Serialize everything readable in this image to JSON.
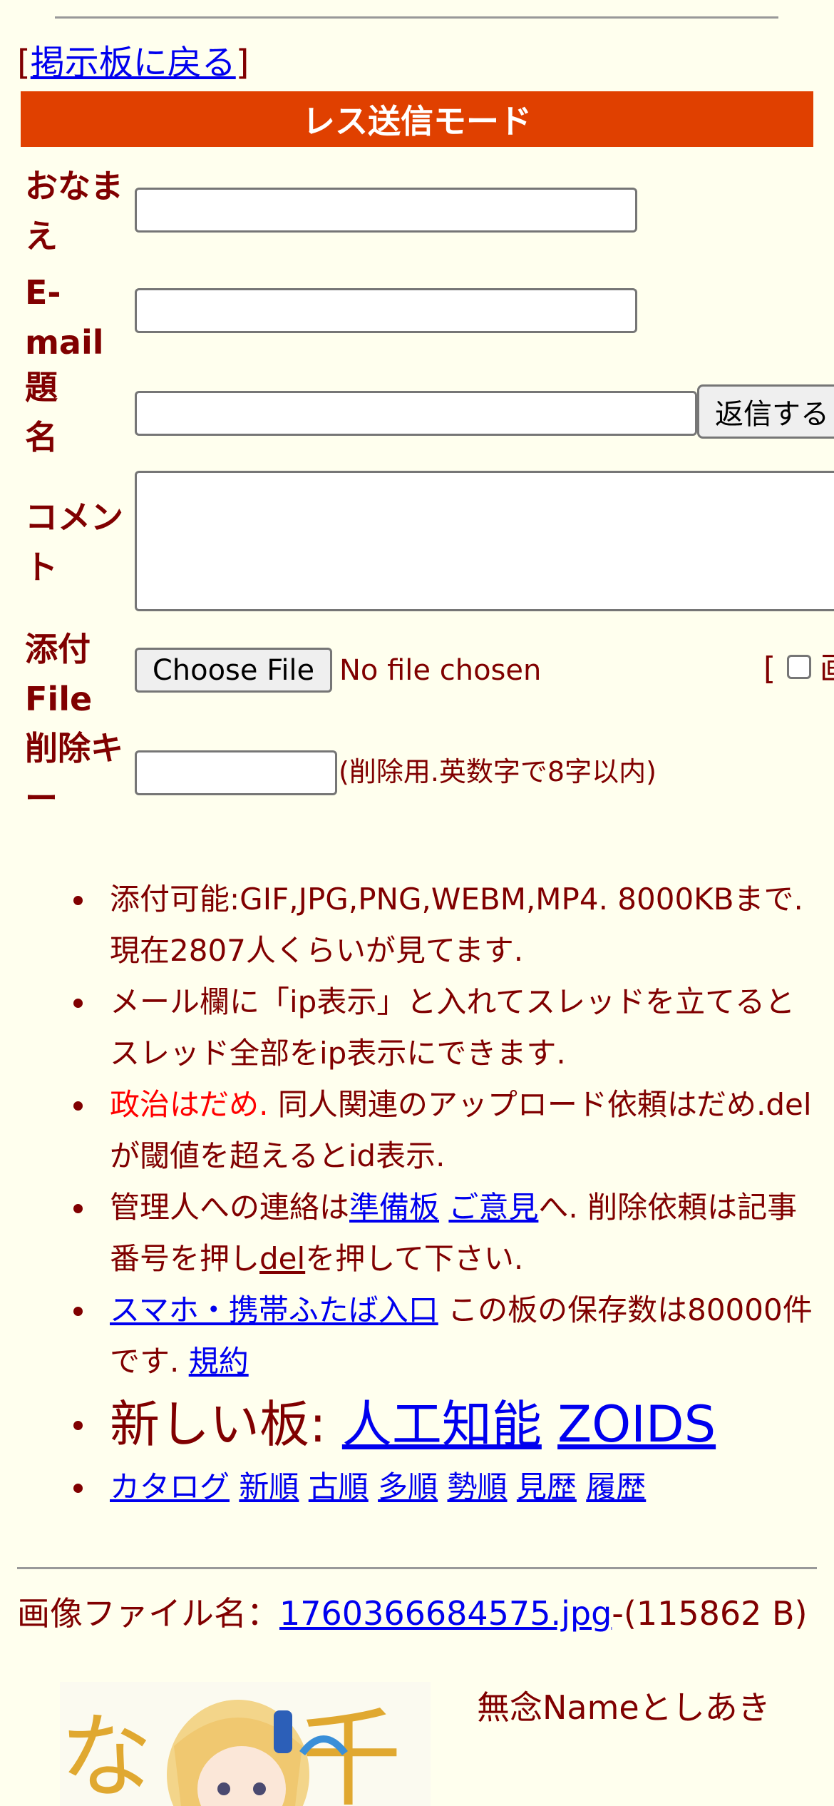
{
  "nav": {
    "back_open": "[",
    "back_label": "掲示板に戻る",
    "back_close": "]"
  },
  "form": {
    "mode_title": "レス送信モード",
    "name_label": "おなまえ",
    "email_label": "E-mail",
    "subject_label": "題名",
    "submit_label": "返信する",
    "comment_label": "コメント",
    "attach_label": "添付File",
    "choose_file_label": "Choose File",
    "no_file_text": "No file chosen",
    "option_bracket": "[",
    "option_cut_text": "画",
    "delkey_label": "削除キー",
    "delkey_note": "(削除用.英数字で8字以内)"
  },
  "notes": {
    "n1": "添付可能:GIF,JPG,PNG,WEBM,MP4. 8000KBまで. 現在2807人くらいが見てます.",
    "n2": "メール欄に「ip表示」と入れてスレッドを立てるとスレッド全部をip表示にできます.",
    "n3_red": "政治はだめ.",
    "n3_rest": " 同人関連のアップロード依頼はだめ.delが閾値を超えるとid表示.",
    "n4_pre": "管理人への連絡は",
    "n4_link1": "準備板",
    "n4_link2": "ご意見",
    "n4_mid": "へ. 削除依頼は記事番号を押し",
    "n4_link3": "del",
    "n4_post": "を押して下さい.",
    "n5_link": "スマホ・携帯ふたば入口",
    "n5_mid": " この板の保存数は80000件です. ",
    "n5_link2": "規約",
    "n6_pre": "新しい板: ",
    "n6_link1": "人工知能",
    "n6_link2": "ZOIDS",
    "sort_links": [
      "カタログ",
      "新順",
      "古順",
      "多順",
      "勢順",
      "見歴",
      "履歴"
    ]
  },
  "post": {
    "file_prefix": "画像ファイル名：",
    "file_name": "1760366684575.jpg",
    "file_size": "-(115862 B)",
    "poster_name": "無念Nameとしあき"
  },
  "colors": {
    "background": "#ffffee",
    "text": "#800000",
    "banner": "#e04000",
    "link": "#0000ee",
    "warning": "#ff0000"
  }
}
